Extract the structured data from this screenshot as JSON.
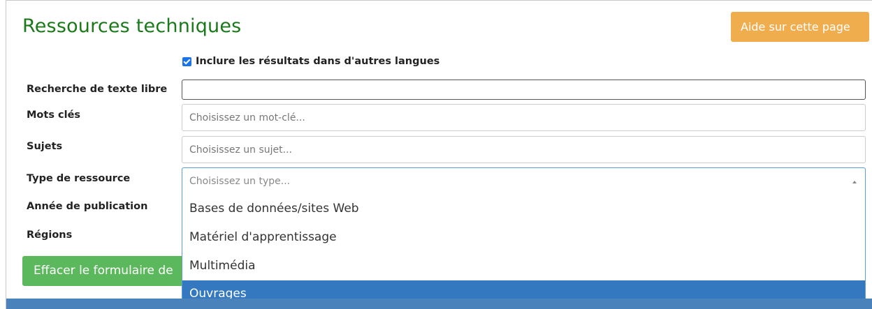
{
  "page": {
    "title": "Ressources techniques",
    "help_label": "Aide sur cette page"
  },
  "form": {
    "include_other_languages": {
      "label": "Inclure les résultats dans d'autres langues",
      "checked": true
    },
    "free_text": {
      "label": "Recherche de texte libre",
      "value": "",
      "placeholder": ""
    },
    "keywords": {
      "label": "Mots clés",
      "placeholder": "Choisissez un mot-clé..."
    },
    "subjects": {
      "label": "Sujets",
      "placeholder": "Choisissez un sujet..."
    },
    "resource_type": {
      "label": "Type de ressource",
      "placeholder": "Choisissez un type...",
      "options": [
        "Bases de données/sites Web",
        "Matériel d'apprentissage",
        "Multimédia",
        "Ouvrages"
      ],
      "highlighted": "Ouvrages"
    },
    "publication_year": {
      "label": "Année de publication"
    },
    "regions": {
      "label": "Régions"
    },
    "clear_label": "Effacer le formulaire de"
  },
  "colors": {
    "title": "#1a7a1a",
    "help_button": "#f0ad4e",
    "clear_button": "#5cb85c",
    "highlight": "#3478bf"
  }
}
